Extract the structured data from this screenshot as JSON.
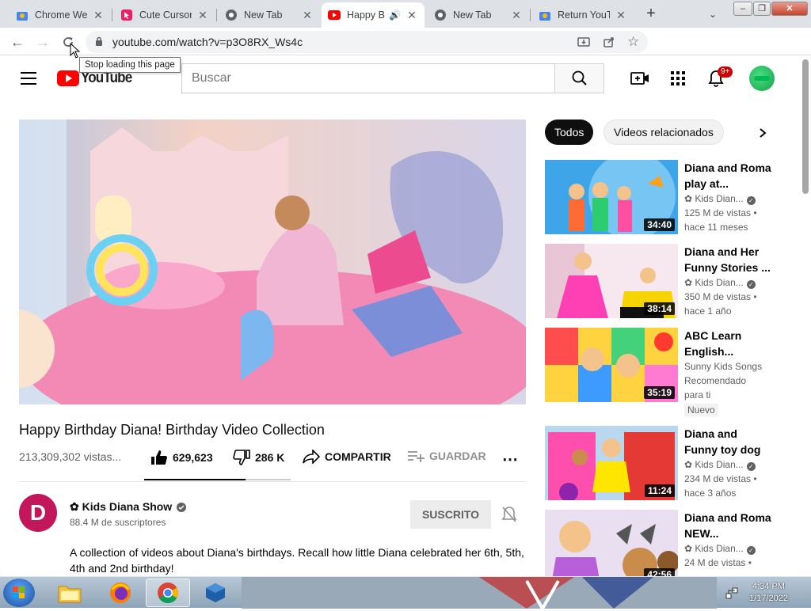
{
  "browser": {
    "tabs": [
      {
        "title": "Chrome Web",
        "icon": "chrome-web-store-icon",
        "active": false
      },
      {
        "title": "Cute Cursor",
        "icon": "cute-cursor-icon",
        "active": false
      },
      {
        "title": "New Tab",
        "icon": "chrome-icon",
        "active": false
      },
      {
        "title": "Happy B",
        "icon": "youtube-icon",
        "active": true
      },
      {
        "title": "New Tab",
        "icon": "chrome-icon",
        "active": false
      },
      {
        "title": "Return YouTu",
        "icon": "chrome-web-store-icon",
        "active": false
      }
    ],
    "url": "youtube.com/watch?v=p3O8RX_Ws4c",
    "tooltip": "Stop loading this page"
  },
  "youtube": {
    "search_placeholder": "Buscar",
    "notification_badge": "9+",
    "logo_text": "YouTube",
    "video": {
      "title": "Happy Birthday Diana! Birthday Video Collection",
      "views": "213,309,302 vistas...",
      "likes": "629,623",
      "dislikes": "286 K",
      "share_label": "COMPARTIR",
      "save_label": "GUARDAR",
      "like_ratio": 0.69
    },
    "channel": {
      "name": "✿ Kids Diana Show",
      "subscribers": "88.4 M de suscriptores",
      "subscribed_label": "SUSCRITO",
      "avatar_letter": "D"
    },
    "description": "A collection of videos about Diana's birthdays. Recall how little Diana celebrated her 6th, 5th, 4th and 2nd birthday!",
    "chips": [
      "Todos",
      "Videos relacionados"
    ],
    "recommendations": [
      {
        "title": "Diana and Roma play at...",
        "channel": "✿ Kids Dian...",
        "verified": true,
        "views": "125 M de vistas",
        "age": "hace 11 meses",
        "duration": "34:40"
      },
      {
        "title": "Diana and Her Funny Stories ...",
        "channel": "✿ Kids Dian...",
        "verified": true,
        "views": "350 M de vistas",
        "age": "hace 1 año",
        "duration": "38:14"
      },
      {
        "title": "ABC Learn English...",
        "channel": "Sunny Kids Songs",
        "verified": false,
        "views": "Recomendado",
        "age": "para ti",
        "badge": "Nuevo",
        "duration": "35:19"
      },
      {
        "title": "Diana and Funny toy dog",
        "channel": "✿ Kids Dian...",
        "verified": true,
        "views": "234 M de vistas",
        "age": "hace 3 años",
        "duration": "11:24"
      },
      {
        "title": "Diana and Roma NEW...",
        "channel": "✿ Kids Dian...",
        "verified": true,
        "views": "24 M de vistas",
        "age": "",
        "duration": "42:56"
      }
    ]
  },
  "taskbar": {
    "time": "4:34 PM",
    "date": "1/17/2022"
  }
}
